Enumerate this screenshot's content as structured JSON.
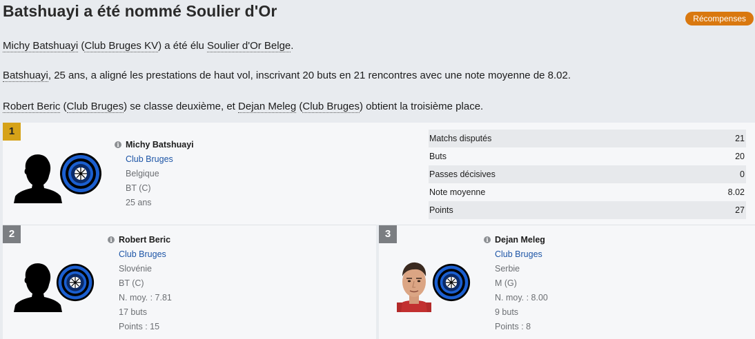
{
  "header": {
    "title": "Batshuayi a été nommé Soulier d'Or",
    "badge": "Récompenses"
  },
  "paragraphs": {
    "p1": {
      "player": "Michy Batshuayi",
      "open": " (",
      "club": "Club Bruges KV",
      "mid": ") a été élu ",
      "award": "Soulier d'Or Belge",
      "end": "."
    },
    "p2": {
      "player": "Batshuayi",
      "rest": ", 25 ans, a aligné les prestations de haut vol, inscrivant 20 buts en 21 rencontres avec une note moyenne de 8.02."
    },
    "p3": {
      "second": "Robert Beric",
      "open1": " (",
      "club1": "Club Bruges",
      "mid": ") se classe deuxième, et ",
      "third": "Dejan Meleg",
      "open2": " (",
      "club2": "Club Bruges",
      "end": ") obtient la troisième place."
    }
  },
  "first": {
    "rank": "1",
    "name": "Michy Batshuayi",
    "club": "Club Bruges",
    "nation": "Belgique",
    "position": "BT (C)",
    "age": "25 ans",
    "stats": [
      {
        "label": "Matchs disputés",
        "value": "21"
      },
      {
        "label": "Buts",
        "value": "20"
      },
      {
        "label": "Passes décisives",
        "value": "0"
      },
      {
        "label": "Note moyenne",
        "value": "8.02"
      },
      {
        "label": "Points",
        "value": "27"
      }
    ]
  },
  "second": {
    "rank": "2",
    "name": "Robert Beric",
    "club": "Club Bruges",
    "nation": "Slovénie",
    "position": "BT (C)",
    "rating": "N. moy. : 7.81",
    "goals": "17 buts",
    "points": "Points : 15"
  },
  "third": {
    "rank": "3",
    "name": "Dejan Meleg",
    "club": "Club Bruges",
    "nation": "Serbie",
    "position": "M (G)",
    "rating": "N. moy. : 8.00",
    "goals": "9 buts",
    "points": "Points : 8"
  },
  "colors": {
    "accent": "#d9780f",
    "gold": "#d6a218",
    "link": "#1d55a6",
    "crest_blue": "#1b5fd0"
  }
}
